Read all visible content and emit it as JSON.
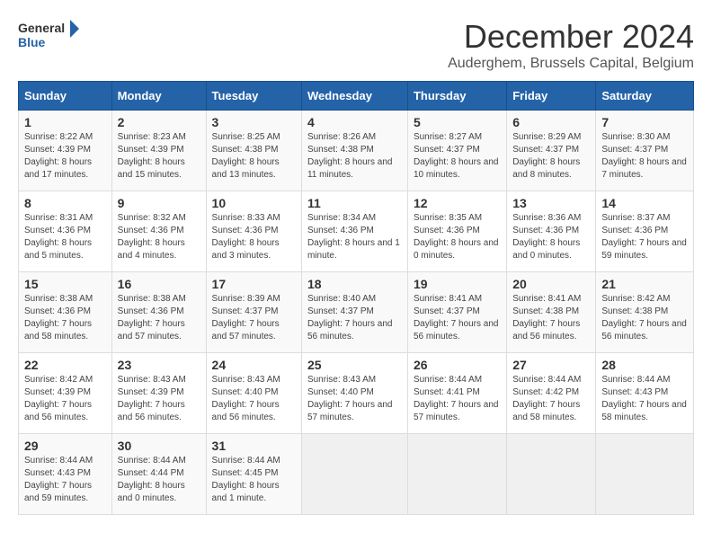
{
  "logo": {
    "line1": "General",
    "line2": "Blue"
  },
  "title": "December 2024",
  "subtitle": "Auderghem, Brussels Capital, Belgium",
  "columns": [
    "Sunday",
    "Monday",
    "Tuesday",
    "Wednesday",
    "Thursday",
    "Friday",
    "Saturday"
  ],
  "weeks": [
    [
      {
        "day": "1",
        "sunrise": "8:22 AM",
        "sunset": "4:39 PM",
        "daylight": "8 hours and 17 minutes."
      },
      {
        "day": "2",
        "sunrise": "8:23 AM",
        "sunset": "4:39 PM",
        "daylight": "8 hours and 15 minutes."
      },
      {
        "day": "3",
        "sunrise": "8:25 AM",
        "sunset": "4:38 PM",
        "daylight": "8 hours and 13 minutes."
      },
      {
        "day": "4",
        "sunrise": "8:26 AM",
        "sunset": "4:38 PM",
        "daylight": "8 hours and 11 minutes."
      },
      {
        "day": "5",
        "sunrise": "8:27 AM",
        "sunset": "4:37 PM",
        "daylight": "8 hours and 10 minutes."
      },
      {
        "day": "6",
        "sunrise": "8:29 AM",
        "sunset": "4:37 PM",
        "daylight": "8 hours and 8 minutes."
      },
      {
        "day": "7",
        "sunrise": "8:30 AM",
        "sunset": "4:37 PM",
        "daylight": "8 hours and 7 minutes."
      }
    ],
    [
      {
        "day": "8",
        "sunrise": "8:31 AM",
        "sunset": "4:36 PM",
        "daylight": "8 hours and 5 minutes."
      },
      {
        "day": "9",
        "sunrise": "8:32 AM",
        "sunset": "4:36 PM",
        "daylight": "8 hours and 4 minutes."
      },
      {
        "day": "10",
        "sunrise": "8:33 AM",
        "sunset": "4:36 PM",
        "daylight": "8 hours and 3 minutes."
      },
      {
        "day": "11",
        "sunrise": "8:34 AM",
        "sunset": "4:36 PM",
        "daylight": "8 hours and 1 minute."
      },
      {
        "day": "12",
        "sunrise": "8:35 AM",
        "sunset": "4:36 PM",
        "daylight": "8 hours and 0 minutes."
      },
      {
        "day": "13",
        "sunrise": "8:36 AM",
        "sunset": "4:36 PM",
        "daylight": "8 hours and 0 minutes."
      },
      {
        "day": "14",
        "sunrise": "8:37 AM",
        "sunset": "4:36 PM",
        "daylight": "7 hours and 59 minutes."
      }
    ],
    [
      {
        "day": "15",
        "sunrise": "8:38 AM",
        "sunset": "4:36 PM",
        "daylight": "7 hours and 58 minutes."
      },
      {
        "day": "16",
        "sunrise": "8:38 AM",
        "sunset": "4:36 PM",
        "daylight": "7 hours and 57 minutes."
      },
      {
        "day": "17",
        "sunrise": "8:39 AM",
        "sunset": "4:37 PM",
        "daylight": "7 hours and 57 minutes."
      },
      {
        "day": "18",
        "sunrise": "8:40 AM",
        "sunset": "4:37 PM",
        "daylight": "7 hours and 56 minutes."
      },
      {
        "day": "19",
        "sunrise": "8:41 AM",
        "sunset": "4:37 PM",
        "daylight": "7 hours and 56 minutes."
      },
      {
        "day": "20",
        "sunrise": "8:41 AM",
        "sunset": "4:38 PM",
        "daylight": "7 hours and 56 minutes."
      },
      {
        "day": "21",
        "sunrise": "8:42 AM",
        "sunset": "4:38 PM",
        "daylight": "7 hours and 56 minutes."
      }
    ],
    [
      {
        "day": "22",
        "sunrise": "8:42 AM",
        "sunset": "4:39 PM",
        "daylight": "7 hours and 56 minutes."
      },
      {
        "day": "23",
        "sunrise": "8:43 AM",
        "sunset": "4:39 PM",
        "daylight": "7 hours and 56 minutes."
      },
      {
        "day": "24",
        "sunrise": "8:43 AM",
        "sunset": "4:40 PM",
        "daylight": "7 hours and 56 minutes."
      },
      {
        "day": "25",
        "sunrise": "8:43 AM",
        "sunset": "4:40 PM",
        "daylight": "7 hours and 57 minutes."
      },
      {
        "day": "26",
        "sunrise": "8:44 AM",
        "sunset": "4:41 PM",
        "daylight": "7 hours and 57 minutes."
      },
      {
        "day": "27",
        "sunrise": "8:44 AM",
        "sunset": "4:42 PM",
        "daylight": "7 hours and 58 minutes."
      },
      {
        "day": "28",
        "sunrise": "8:44 AM",
        "sunset": "4:43 PM",
        "daylight": "7 hours and 58 minutes."
      }
    ],
    [
      {
        "day": "29",
        "sunrise": "8:44 AM",
        "sunset": "4:43 PM",
        "daylight": "7 hours and 59 minutes."
      },
      {
        "day": "30",
        "sunrise": "8:44 AM",
        "sunset": "4:44 PM",
        "daylight": "8 hours and 0 minutes."
      },
      {
        "day": "31",
        "sunrise": "8:44 AM",
        "sunset": "4:45 PM",
        "daylight": "8 hours and 1 minute."
      },
      null,
      null,
      null,
      null
    ]
  ]
}
